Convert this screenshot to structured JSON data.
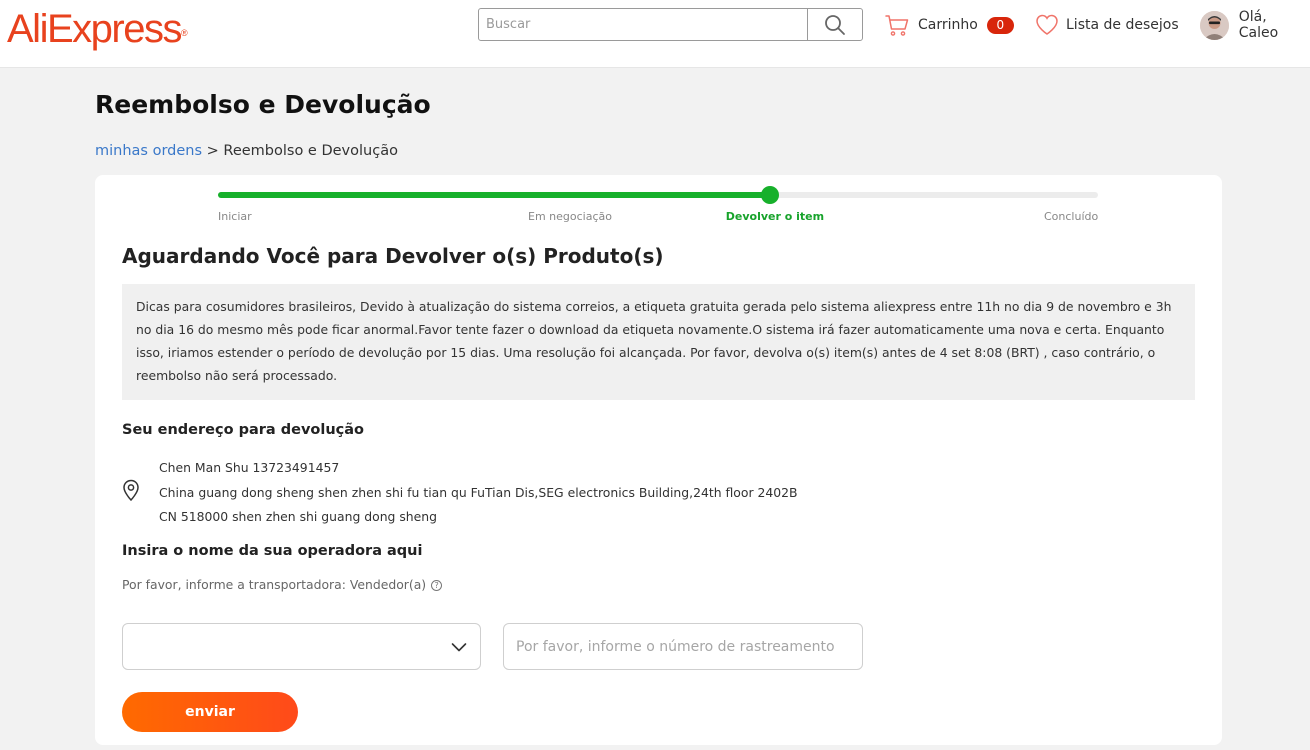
{
  "header": {
    "logo": "AliExpress",
    "logo_mark": "®",
    "search_placeholder": "Buscar",
    "cart_label": "Carrinho",
    "cart_count": "0",
    "wishlist_label": "Lista de desejos",
    "user_greeting": "Olá, Caleo"
  },
  "colors": {
    "brand": "#e8421e",
    "progress": "#17b02b",
    "badge": "#d8260b",
    "button": "#ff5a10",
    "link": "#3a78c9"
  },
  "page": {
    "title": "Reembolso e Devolução",
    "breadcrumb": {
      "link": "minhas ordens",
      "separator": ">",
      "current": "Reembolso e Devolução"
    }
  },
  "progress": {
    "steps": [
      "Iniciar",
      "Em negociação",
      "Devolver o item",
      "Concluído"
    ],
    "active_index": 2,
    "progress_fraction": 0.627
  },
  "main": {
    "heading": "Aguardando Você para Devolver o(s) Produto(s)",
    "notice": "Dicas para cosumidores brasileiros, Devido à atualização do sistema correios, a etiqueta gratuita gerada pelo sistema aliexpress entre 11h no dia 9 de novembro e 3h no dia 16 do mesmo mês pode ficar anormal.Favor tente fazer o download da etiqueta novamente.O sistema irá fazer automaticamente uma nova e certa. Enquanto isso, iriamos estender o período de devolução por 15 dias. Uma resolução foi alcançada. Por favor, devolva o(s) item(s) antes de 4 set 8:08 (BRT) , caso contrário, o reembolso não será processado.",
    "address": {
      "title": "Seu endereço para devolução",
      "lines": [
        "Chen Man Shu 13723491457",
        "China guang dong sheng shen zhen shi fu tian qu FuTian Dis,SEG electronics Building,24th floor 2402B",
        "CN 518000 shen zhen shi guang dong sheng"
      ]
    },
    "carrier": {
      "title": "Insira o nome da sua operadora aqui",
      "note": "Por favor, informe a transportadora: Vendedor(a)",
      "select_value": "",
      "tracking_value": "",
      "tracking_placeholder": "Por favor, informe o número de rastreamento"
    },
    "submit_label": "enviar"
  }
}
